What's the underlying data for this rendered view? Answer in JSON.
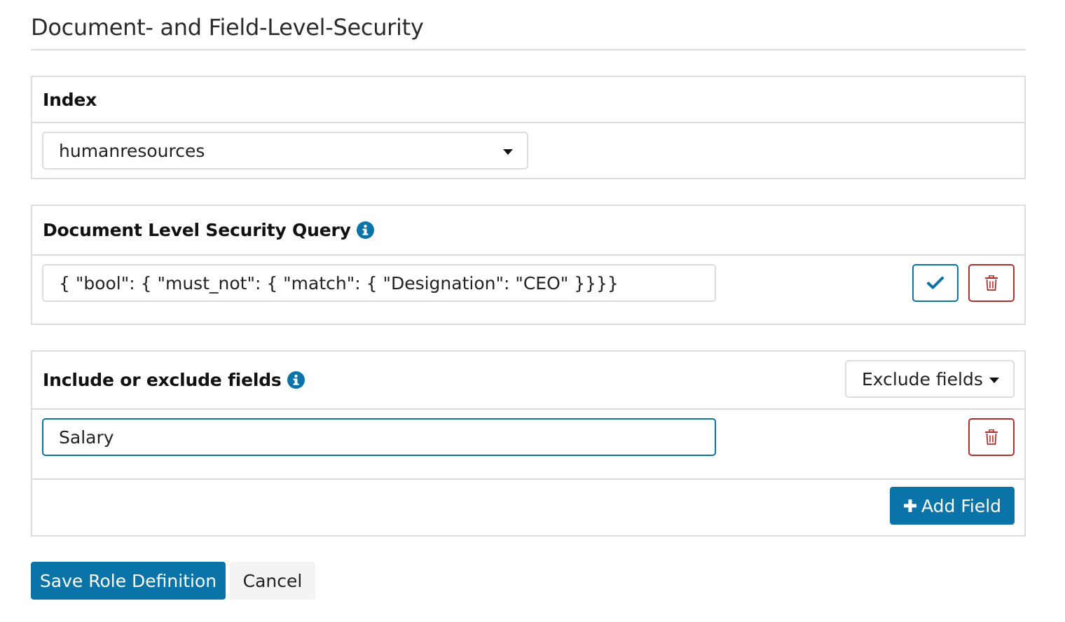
{
  "page": {
    "title": "Document- and Field-Level-Security"
  },
  "index_panel": {
    "label": "Index",
    "selected_index": "humanresources"
  },
  "dls_panel": {
    "label": "Document Level Security Query",
    "query": "{ \"bool\": { \"must_not\": { \"match\": { \"Designation\": \"CEO\"  }}}}",
    "confirm_icon": "check-icon",
    "delete_icon": "trash-icon"
  },
  "fls_panel": {
    "label": "Include or exclude fields",
    "mode_selected": "Exclude fields",
    "fields": [
      {
        "value": "Salary"
      }
    ],
    "delete_icon": "trash-icon",
    "add_field_label": "Add Field"
  },
  "footer": {
    "save_label": "Save Role Definition",
    "cancel_label": "Cancel"
  },
  "colors": {
    "primary": "#0a73a8",
    "danger": "#b32d2d",
    "border": "#dddddd"
  }
}
